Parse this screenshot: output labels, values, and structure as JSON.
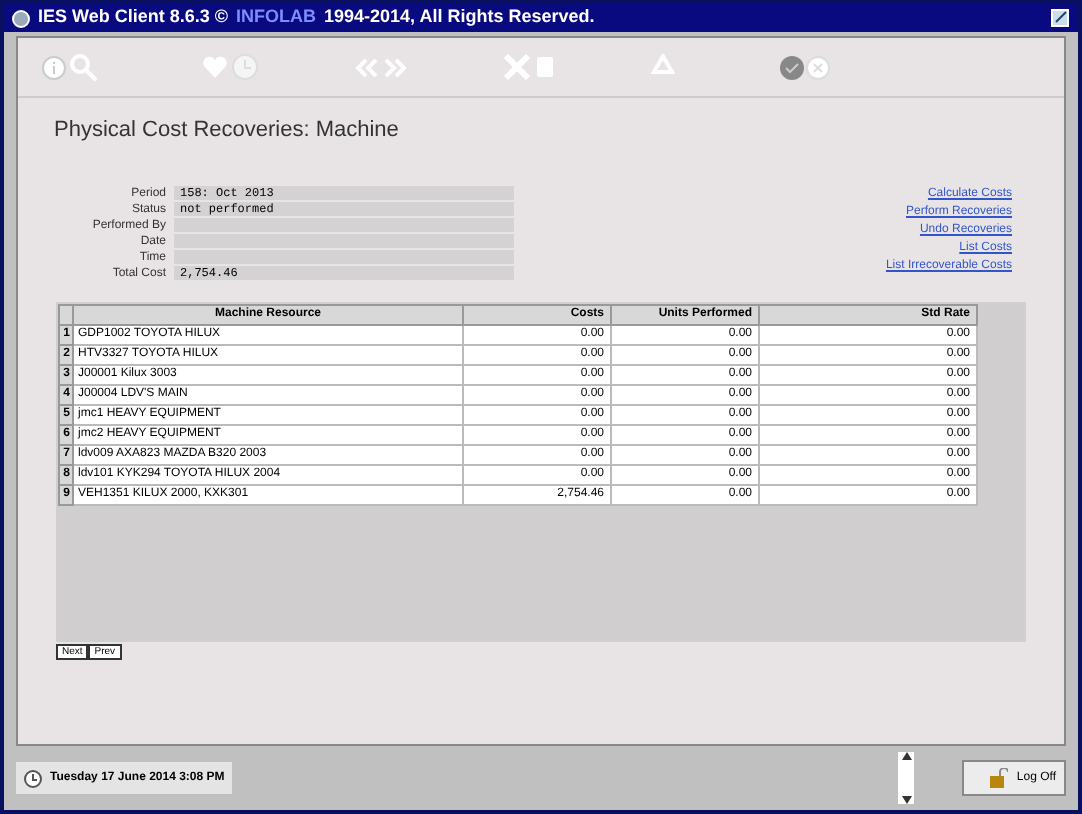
{
  "window": {
    "title_prefix": "IES Web Client 8.6.3 ©",
    "brand": "INFOLAB",
    "title_suffix": "1994-2014, All Rights Reserved."
  },
  "page_title": "Physical Cost Recoveries: Machine",
  "form": [
    {
      "label": "Period",
      "value": "158: Oct 2013"
    },
    {
      "label": "Status",
      "value": "not performed"
    },
    {
      "label": "Performed By"
    },
    {
      "label": "Date"
    },
    {
      "label": "Time"
    },
    {
      "label": "Total Cost",
      "value": "2,754.46"
    }
  ],
  "links": [
    "Calculate Costs",
    "Perform Recoveries",
    "Undo Recoveries",
    "List Costs",
    "List Irrecoverable Costs"
  ],
  "table": {
    "columns": [
      "Machine Resource",
      "Costs",
      "Units Performed",
      "Std Rate"
    ],
    "rows": [
      {
        "number": "1",
        "cells": [
          "GDP1002 TOYOTA HILUX",
          "0.00",
          "0.00",
          "0.00"
        ]
      },
      {
        "number": "2",
        "cells": [
          "HTV3327 TOYOTA HILUX",
          "0.00",
          "0.00",
          "0.00"
        ]
      },
      {
        "number": "3",
        "cells": [
          "J00001 Kilux 3003",
          "0.00",
          "0.00",
          "0.00"
        ]
      },
      {
        "number": "4",
        "cells": [
          "J00004 LDV'S MAIN",
          "0.00",
          "0.00",
          "0.00"
        ]
      },
      {
        "number": "5",
        "cells": [
          "jmc1 HEAVY EQUIPMENT",
          "0.00",
          "0.00",
          "0.00"
        ]
      },
      {
        "number": "6",
        "cells": [
          "jmc2 HEAVY EQUIPMENT",
          "0.00",
          "0.00",
          "0.00"
        ]
      },
      {
        "number": "7",
        "cells": [
          "ldv009 AXA823 MAZDA B320 2003",
          "0.00",
          "0.00",
          "0.00"
        ]
      },
      {
        "number": "8",
        "cells": [
          "ldv101 KYK294 TOYOTA HILUX 2004",
          "0.00",
          "0.00",
          "0.00"
        ]
      },
      {
        "number": "9",
        "cells": [
          "VEH1351 KILUX 2000, KXK301",
          "2,754.46",
          "0.00",
          "0.00"
        ]
      }
    ]
  },
  "pager": [
    "Next",
    "Prev"
  ],
  "status_bar": {
    "datetime": "Tuesday 17 June 2014 3:08 PM",
    "logoff": "Log Off"
  }
}
